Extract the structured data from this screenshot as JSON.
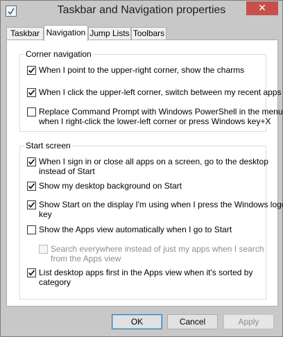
{
  "window": {
    "title": "Taskbar and Navigation properties",
    "close_label": "✕"
  },
  "tabs": [
    {
      "label": "Taskbar",
      "active": false
    },
    {
      "label": "Navigation",
      "active": true
    },
    {
      "label": "Jump Lists",
      "active": false
    },
    {
      "label": "Toolbars",
      "active": false
    }
  ],
  "corner_navigation": {
    "title": "Corner navigation",
    "options": [
      {
        "lines": [
          "When I point to the upper-right corner, show the charms"
        ],
        "checked": true,
        "enabled": true
      },
      {
        "lines": [
          "When I click the upper-left corner, switch between my recent apps"
        ],
        "checked": true,
        "enabled": true
      },
      {
        "lines": [
          "Replace Command Prompt with Windows PowerShell in the menu",
          "when I right-click the lower-left corner or press Windows key+X"
        ],
        "checked": false,
        "enabled": true
      }
    ]
  },
  "start_screen": {
    "title": "Start screen",
    "options": [
      {
        "lines": [
          "When I sign in or close all apps on a screen, go to the desktop",
          "instead of Start"
        ],
        "checked": true,
        "enabled": true
      },
      {
        "lines": [
          "Show my desktop background on Start"
        ],
        "checked": true,
        "enabled": true
      },
      {
        "lines": [
          "Show Start on the display I'm using when I press the Windows logo",
          "key"
        ],
        "checked": true,
        "enabled": true
      },
      {
        "lines": [
          "Show the Apps view automatically when I go to Start"
        ],
        "checked": false,
        "enabled": true
      },
      {
        "lines": [
          "Search everywhere instead of just my apps when I search",
          "from the Apps view"
        ],
        "checked": false,
        "enabled": false
      },
      {
        "lines": [
          "List desktop apps first in the Apps view when it's sorted by",
          "category"
        ],
        "checked": true,
        "enabled": true
      }
    ]
  },
  "buttons": {
    "ok": "OK",
    "cancel": "Cancel",
    "apply": "Apply"
  },
  "colors": {
    "close": "#c7504b",
    "window": "#c8c8c8",
    "panel": "#ffffff"
  }
}
